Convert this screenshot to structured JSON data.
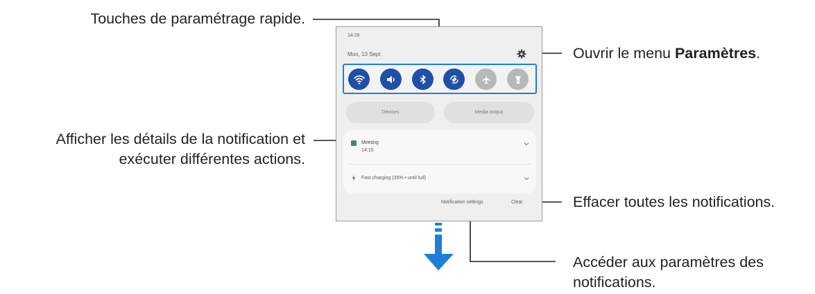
{
  "callouts": {
    "quick_settings": "Touches de paramétrage rapide.",
    "open_settings_prefix": "Ouvrir le menu ",
    "open_settings_bold": "Paramètres",
    "open_settings_suffix": ".",
    "notif_details_line1": "Afficher les détails de la notification et",
    "notif_details_line2": "exécuter différentes actions.",
    "clear_all": "Effacer toutes les notifications.",
    "notif_settings_line1": "Accéder aux paramètres des",
    "notif_settings_line2": "notifications."
  },
  "panel": {
    "time": "14:26",
    "date": "Mon, 13 Sept",
    "quick_toggles": [
      {
        "icon": "wifi-icon",
        "state": "on"
      },
      {
        "icon": "sound-icon",
        "state": "on"
      },
      {
        "icon": "bluetooth-icon",
        "state": "on"
      },
      {
        "icon": "auto-rotate-icon",
        "state": "on"
      },
      {
        "icon": "airplane-icon",
        "state": "off"
      },
      {
        "icon": "flashlight-icon",
        "state": "off"
      }
    ],
    "devices_label": "Devices",
    "media_output_label": "Media output",
    "notification1_title": "Meeting",
    "notification1_sub": "14:15",
    "notification2_title": "Fast charging (35% • until full)",
    "notification_settings_label": "Notification settings",
    "clear_label": "Clear"
  },
  "colors": {
    "accent": "#1f7fd6",
    "toggle_on": "#1f4fa8",
    "toggle_off": "#b8b8b8",
    "arrow": "#1f7fd6"
  }
}
